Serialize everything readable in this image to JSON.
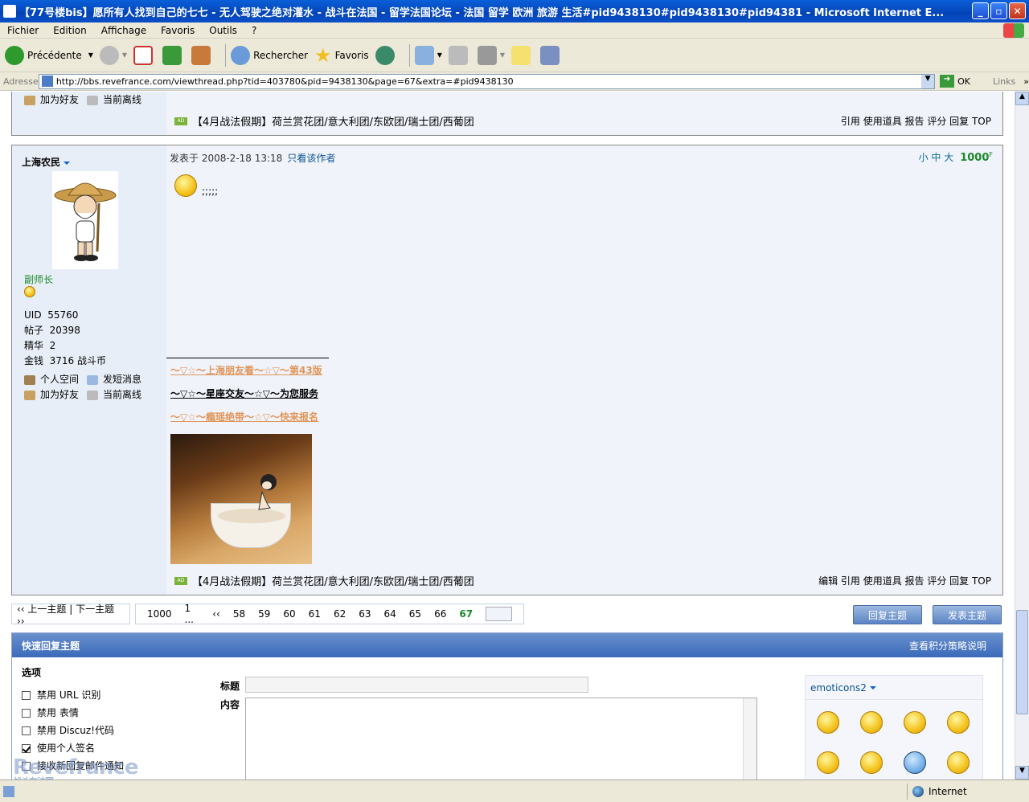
{
  "window": {
    "title": "【77号楼bis】愿所有人找到自己的七七 - 无人驾驶之绝对灌水 - 战斗在法国 - 留学法国论坛 - 法国 留学 欧洲 旅游 生活#pid9438130#pid9438130#pid94381 - Microsoft Internet E..."
  },
  "menu": [
    "Fichier",
    "Edition",
    "Affichage",
    "Favoris",
    "Outils",
    "?"
  ],
  "toolbar": {
    "back": "Précédente",
    "search": "Rechercher",
    "favorites": "Favoris"
  },
  "address": {
    "label": "Adresse",
    "url": "http://bbs.revefrance.com/viewthread.php?tid=403780&pid=9438130&page=67&extra=#pid9438130",
    "go": "OK",
    "links": "Links"
  },
  "prev_post": {
    "links": {
      "add_friend": "加为好友",
      "status": "当前离线"
    },
    "ad": "【4月战法假期】荷兰赏花团/意大利团/东欧团/瑞士团/西葡团",
    "actions": "引用 使用道具 报告 评分 回复 TOP"
  },
  "post": {
    "author": "上海农民",
    "rank": "副师长",
    "stats": {
      "uid_label": "UID",
      "uid": "55760",
      "posts_label": "帖子",
      "posts": "20398",
      "digest_label": "精华",
      "digest": "2",
      "money_label": "金钱",
      "money": "3716 战斗币"
    },
    "links": {
      "space": "个人空间",
      "message": "发短消息",
      "add_friend": "加为好友",
      "status": "当前离线"
    },
    "posted_at": "发表于 2008-2-18 13:18",
    "author_only": "只看该作者",
    "font_sizes": "小 中 大",
    "floor": "1000",
    "floor_sup": "F",
    "body": ";;;;;",
    "signature": [
      "～▽☆～上海朋友看～☆▽～第43版",
      "～▽☆～星座交友～☆▽～为您服务",
      "～▽☆～瘾瑶绝带～☆▽～快来报名"
    ],
    "ad": "【4月战法假期】荷兰赏花团/意大利团/东欧团/瑞士团/西葡团",
    "actions": "编辑 引用 使用道具 报告 评分 回复 TOP"
  },
  "pager": {
    "nav": "‹‹ 上一主题 | 下一主题 ››",
    "total": "1000",
    "first": "1 ...",
    "prev": "‹‹",
    "pages": [
      "58",
      "59",
      "60",
      "61",
      "62",
      "63",
      "64",
      "65",
      "66"
    ],
    "current": "67",
    "reply_btn": "回复主题",
    "new_btn": "发表主题"
  },
  "quick_reply": {
    "title": "快速回复主题",
    "policy": "查看积分策略说明",
    "options_label": "选项",
    "options": [
      {
        "label": "禁用 URL 识别",
        "checked": false
      },
      {
        "label": "禁用 表情",
        "checked": false
      },
      {
        "label": "禁用 Discuz!代码",
        "checked": false
      },
      {
        "label": "使用个人签名",
        "checked": true
      },
      {
        "label": "接收新回复邮件通知",
        "checked": false
      }
    ],
    "subject_label": "标题",
    "content_label": "内容",
    "emoticons_label": "emoticons2"
  },
  "status": {
    "zone": "Internet"
  },
  "watermark": "Revefrance 战斗在法国"
}
